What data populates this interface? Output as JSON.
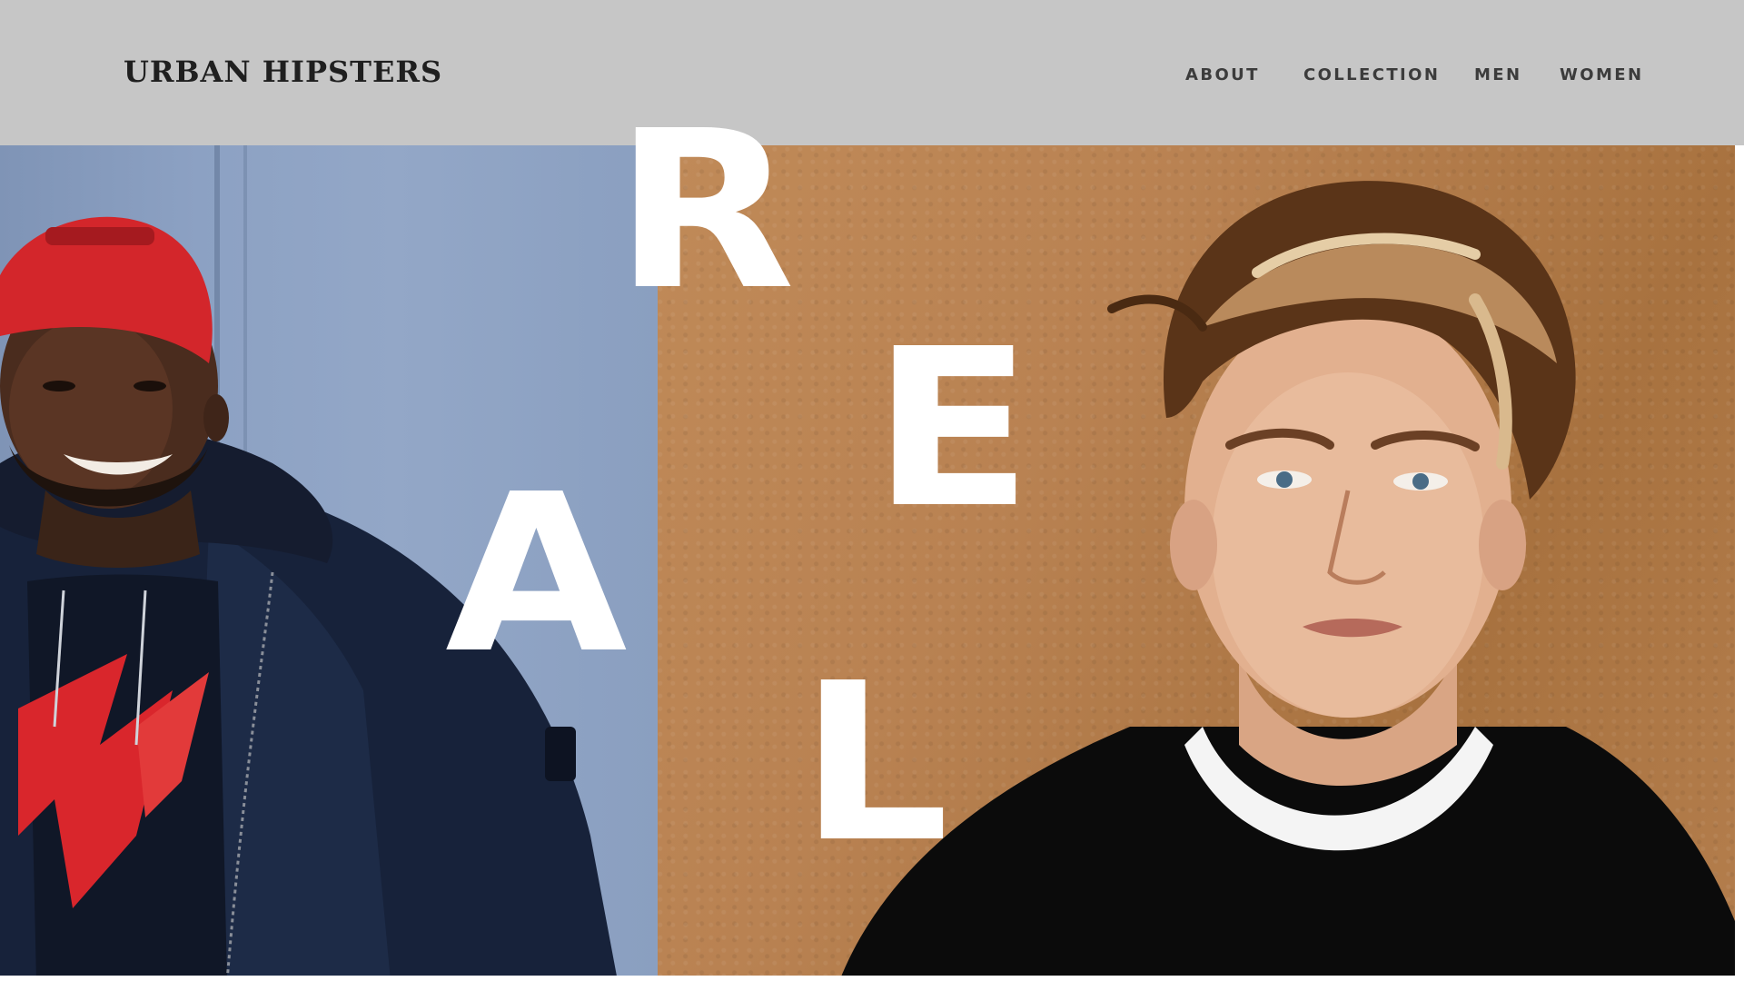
{
  "brand": {
    "logo_text": "URBAN HIPSTERS"
  },
  "nav": {
    "items": [
      {
        "label": "ABOUT"
      },
      {
        "label": "COLLECTION"
      },
      {
        "label": "MEN"
      },
      {
        "label": "WOMEN"
      }
    ]
  },
  "hero": {
    "letters": [
      "R",
      "E",
      "A",
      "L"
    ],
    "left_photo": {
      "subject": "smiling-man-red-cap-navy-jacket-photo",
      "background_color": "#8ca1c3"
    },
    "right_photo": {
      "subject": "young-man-highlighted-hair-black-shirt-photo",
      "background_color": "#b98252"
    }
  },
  "colors": {
    "header_bg": "#c6c6c6",
    "logo_text": "#1f1f1f",
    "nav_text": "#3c3c3c",
    "hero_letter": "#ffffff"
  }
}
